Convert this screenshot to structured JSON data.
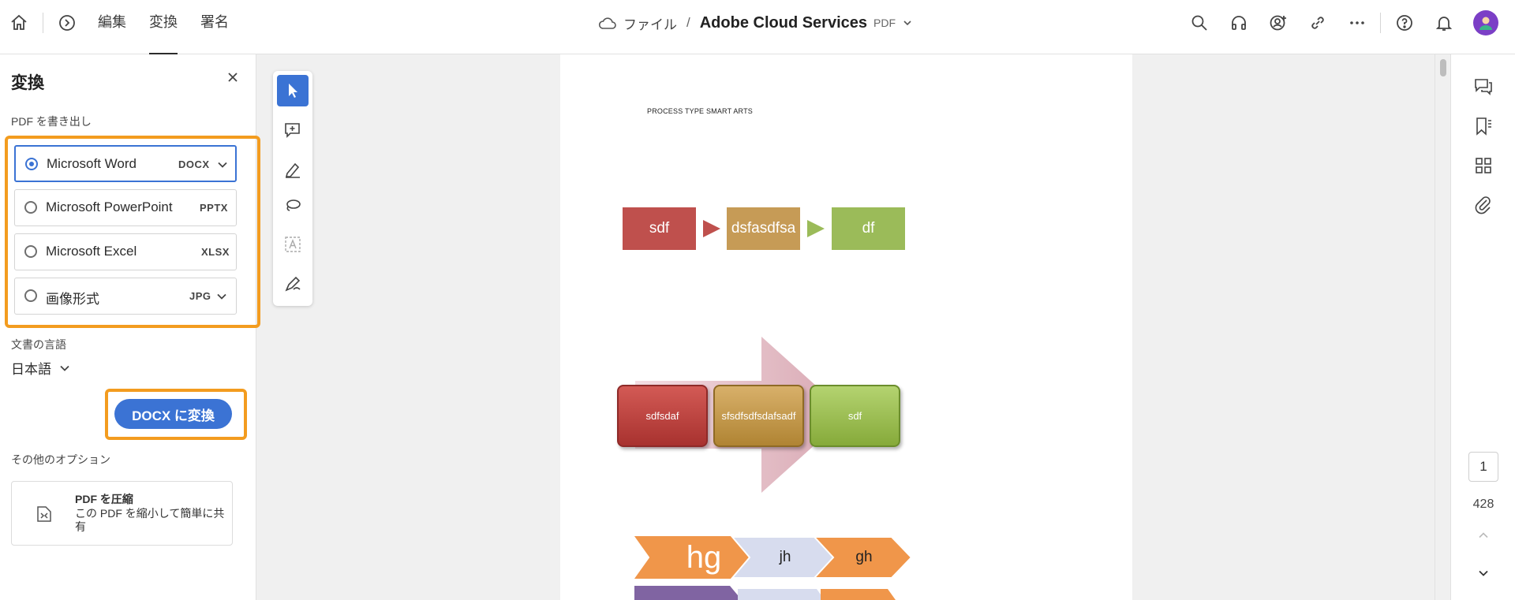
{
  "header": {
    "tabs": [
      {
        "label": "編集"
      },
      {
        "label": "変換"
      },
      {
        "label": "署名"
      }
    ],
    "breadcrumb": {
      "folder": "ファイル",
      "separator": "/",
      "document": "Adobe Cloud Services",
      "format": "PDF"
    },
    "icons": [
      "home-icon",
      "history-icon",
      "search-icon",
      "headphones-icon",
      "share-user-icon",
      "link-icon",
      "more-icon",
      "help-icon",
      "bell-icon",
      "avatar"
    ]
  },
  "panel": {
    "title": "変換",
    "export_label": "PDF を書き出し",
    "options": [
      {
        "label": "Microsoft Word",
        "ext": "DOCX",
        "selected": true,
        "dropdown": true
      },
      {
        "label": "Microsoft PowerPoint",
        "ext": "PPTX",
        "selected": false,
        "dropdown": false
      },
      {
        "label": "Microsoft Excel",
        "ext": "XLSX",
        "selected": false,
        "dropdown": false
      },
      {
        "label": "画像形式",
        "ext": "JPG",
        "selected": false,
        "dropdown": true
      }
    ],
    "language_label": "文書の言語",
    "language_value": "日本語",
    "convert_button": "DOCX に変換",
    "more_options_label": "その他のオプション",
    "compress": {
      "title": "PDF を圧縮",
      "description": "この PDF を縮小して簡単に共有"
    }
  },
  "document": {
    "heading": "PROCESS TYPE SMART ARTS",
    "row1": [
      "sdf",
      "dsfasdfsa",
      "df"
    ],
    "row2": [
      "sdfsdaf",
      "sfsdfsdfsdafsadf",
      "sdf"
    ],
    "row3": [
      "hg",
      "jh",
      "gh"
    ],
    "colors": {
      "red": "#bf504d",
      "gold": "#c69b56",
      "green": "#9bbb59",
      "orange": "#f0964a",
      "lavender": "#d7dcee",
      "purple": "#8064a2"
    }
  },
  "pagination": {
    "current": "1",
    "total": "428"
  },
  "accent": "#3b73d4",
  "highlight": "#f39c1f"
}
